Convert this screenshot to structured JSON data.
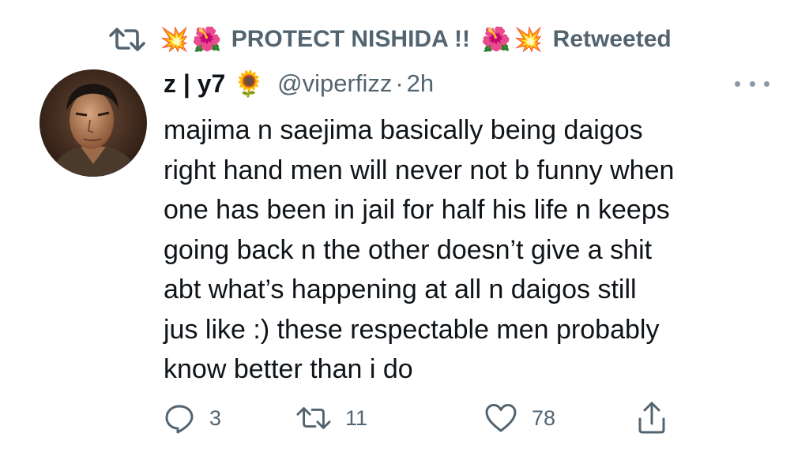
{
  "retweet_header": {
    "prefix_emojis": [
      "💥",
      "🌺"
    ],
    "label": "PROTECT NISHIDA !!",
    "suffix_emojis": [
      "🌺",
      "💥"
    ],
    "status": "Retweeted"
  },
  "tweet": {
    "display_name": "z | y7",
    "name_emoji": "🌻",
    "handle": "@viperfizz",
    "separator": "·",
    "time": "2h",
    "text_lines": [
      "majima n saejima basically being daigos",
      "right hand men will never not b funny when",
      "one has been in jail for half his life n keeps",
      "going back n the other doesn’t give a shit",
      "abt what’s happening at all n daigos still",
      "jus like :) these respectable men probably",
      "know better than i do"
    ]
  },
  "actions": {
    "reply_count": "3",
    "retweet_count": "11",
    "like_count": "78"
  },
  "colors": {
    "text_primary": "#0f1419",
    "text_secondary": "#536471",
    "background": "#ffffff"
  },
  "icons": {
    "retweet": "retweet-icon",
    "reply": "reply-icon",
    "like": "heart-icon",
    "share": "share-icon",
    "more": "more-icon"
  }
}
